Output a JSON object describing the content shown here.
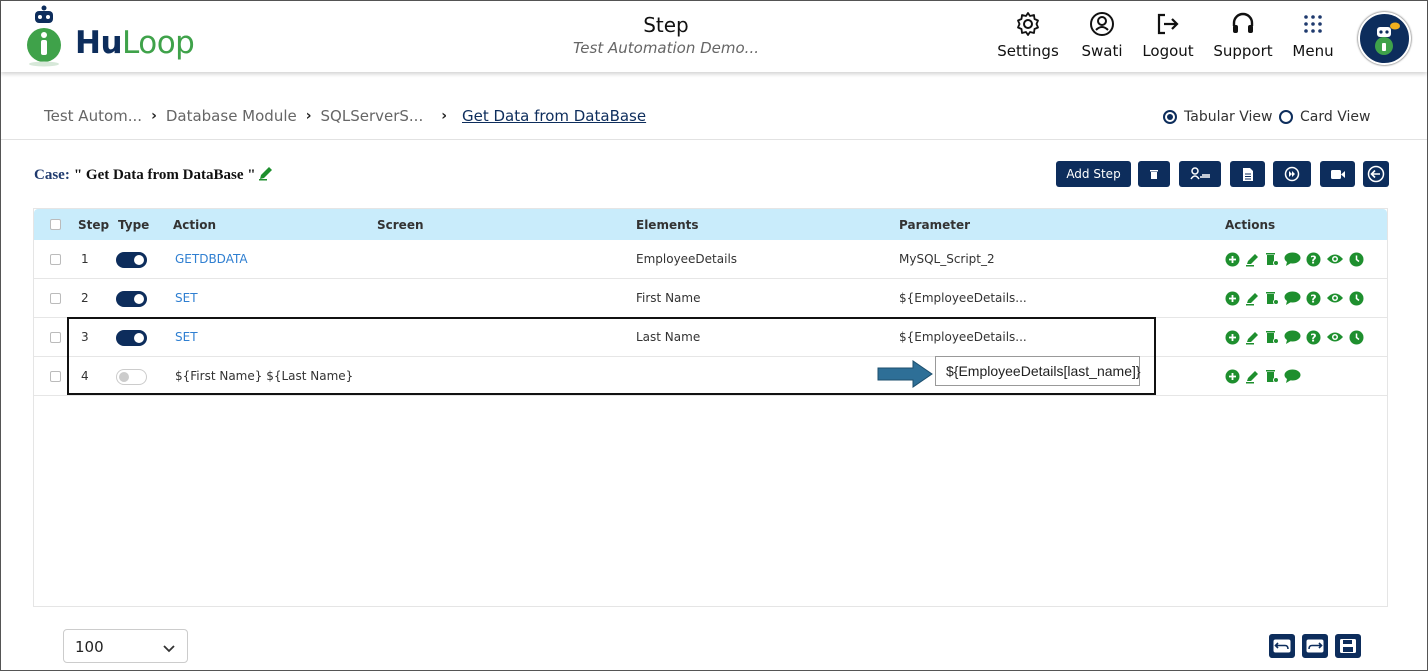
{
  "header": {
    "logo_text_hu": "Hu",
    "logo_text_loop": "Loop",
    "title": "Step",
    "subtitle": "Test Automation Demo...",
    "nav": [
      {
        "label": "Settings",
        "icon": "gear-icon"
      },
      {
        "label": "Swati",
        "icon": "user-icon"
      },
      {
        "label": "Logout",
        "icon": "logout-icon"
      },
      {
        "label": "Support",
        "icon": "headset-icon"
      },
      {
        "label": "Menu",
        "icon": "grid-menu-icon"
      }
    ]
  },
  "breadcrumb": [
    "Test Autom...",
    "Database Module",
    "SQLServerS...",
    "Get Data from DataBase"
  ],
  "view": {
    "tabular": "Tabular View",
    "card": "Card View",
    "selected": "Tabular View"
  },
  "case": {
    "label": "Case:",
    "name": "\" Get Data from DataBase \""
  },
  "toolbar": {
    "add_step": "Add Step"
  },
  "table": {
    "columns": [
      "Step",
      "Type",
      "Action",
      "Screen",
      "Elements",
      "Parameter",
      "Actions"
    ],
    "rows": [
      {
        "step": "1",
        "type_on": true,
        "action": "GETDBDATA",
        "screen": "",
        "elements": "EmployeeDetails",
        "parameter": "MySQL_Script_2"
      },
      {
        "step": "2",
        "type_on": true,
        "action": "SET",
        "screen": "",
        "elements": "First Name",
        "parameter": "${EmployeeDetails..."
      },
      {
        "step": "3",
        "type_on": true,
        "action": "SET",
        "screen": "",
        "elements": "Last Name",
        "parameter": "${EmployeeDetails..."
      },
      {
        "step": "4",
        "type_on": false,
        "action": "${First Name} ${Last Name}",
        "screen": "",
        "elements": "",
        "parameter": ""
      }
    ]
  },
  "callout": {
    "text": "${EmployeeDetails[last_name]}"
  },
  "footer": {
    "page_size": "100"
  },
  "colors": {
    "primary": "#0d2d5c",
    "accent_green": "#3fa24a",
    "icon_green": "#1e8f2e",
    "header_row": "#c9ecfb",
    "link": "#2f7fd1"
  }
}
